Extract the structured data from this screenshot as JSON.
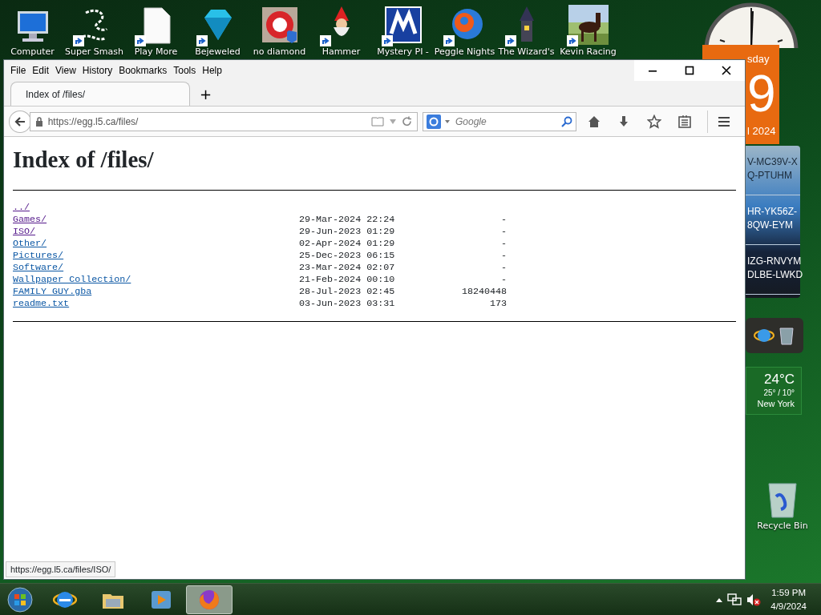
{
  "desktop_icons": [
    {
      "label": "Computer",
      "kind": "monitor",
      "shortcut": false
    },
    {
      "label": "Super Smash",
      "kind": "swirl",
      "shortcut": true
    },
    {
      "label": "Play More",
      "kind": "document",
      "shortcut": true
    },
    {
      "label": "Bejeweled",
      "kind": "gem",
      "shortcut": true
    },
    {
      "label": "no diamond",
      "kind": "redtile",
      "shortcut": false
    },
    {
      "label": "Hammer",
      "kind": "gnome",
      "shortcut": true
    },
    {
      "label": "Mystery PI -",
      "kind": "bluetile",
      "shortcut": true
    },
    {
      "label": "Peggle Nights",
      "kind": "ball",
      "shortcut": true
    },
    {
      "label": "The Wizard's",
      "kind": "tower",
      "shortcut": true
    },
    {
      "label": "Kevin Racing",
      "kind": "picture",
      "shortcut": true
    }
  ],
  "calendar": {
    "day_name": "sday",
    "day": "9",
    "month_year": "l 2024"
  },
  "keys": [
    {
      "lines": [
        "V-MC39V-X",
        "Q-PTUHM"
      ]
    },
    {
      "lines": [
        "HR-YK56Z-",
        "8QW-EYM"
      ]
    },
    {
      "lines": [
        "IZG-RNVYM",
        "DLBE-LWKD"
      ]
    }
  ],
  "weather": {
    "temperature": "24°C",
    "range": "25° / 10°",
    "city": "New York"
  },
  "recycle_bin": {
    "label": "Recycle Bin"
  },
  "browser": {
    "menu": [
      "File",
      "Edit",
      "View",
      "History",
      "Bookmarks",
      "Tools",
      "Help"
    ],
    "tabs": [
      {
        "label": "Index of /files/",
        "selected": true
      }
    ],
    "new_tab": "+",
    "url": "https://egg.l5.ca/files/",
    "search": {
      "placeholder": "Google"
    },
    "page": {
      "title": "Index of /files/",
      "entries": [
        {
          "name": "../",
          "visited": true
        },
        {
          "name": "Games/",
          "date": "29-Mar-2024 22:24",
          "size": "-",
          "visited": true
        },
        {
          "name": "ISO/",
          "date": "29-Jun-2023 01:29",
          "size": "-",
          "visited": true
        },
        {
          "name": "Other/",
          "date": "02-Apr-2024 01:29",
          "size": "-",
          "visited": false
        },
        {
          "name": "Pictures/",
          "date": "25-Dec-2023 06:15",
          "size": "-",
          "visited": false
        },
        {
          "name": "Software/",
          "date": "23-Mar-2024 02:07",
          "size": "-",
          "visited": false
        },
        {
          "name": "Wallpaper Collection/",
          "date": "21-Feb-2024 00:10",
          "size": "-",
          "visited": false
        },
        {
          "name": "FAMILY GUY.gba",
          "date": "28-Jul-2023 02:45",
          "size": "18240448",
          "visited": false
        },
        {
          "name": "readme.txt",
          "date": "03-Jun-2023 03:31",
          "size": "173",
          "visited": false
        }
      ]
    },
    "status_url": "https://egg.l5.ca/files/ISO/"
  },
  "taskbar": {
    "items": [
      {
        "kind": "ie",
        "selected": false
      },
      {
        "kind": "explorer",
        "selected": false
      },
      {
        "kind": "media",
        "selected": false
      },
      {
        "kind": "firefox",
        "selected": true
      }
    ],
    "time": "1:59 PM",
    "date": "4/9/2024"
  }
}
